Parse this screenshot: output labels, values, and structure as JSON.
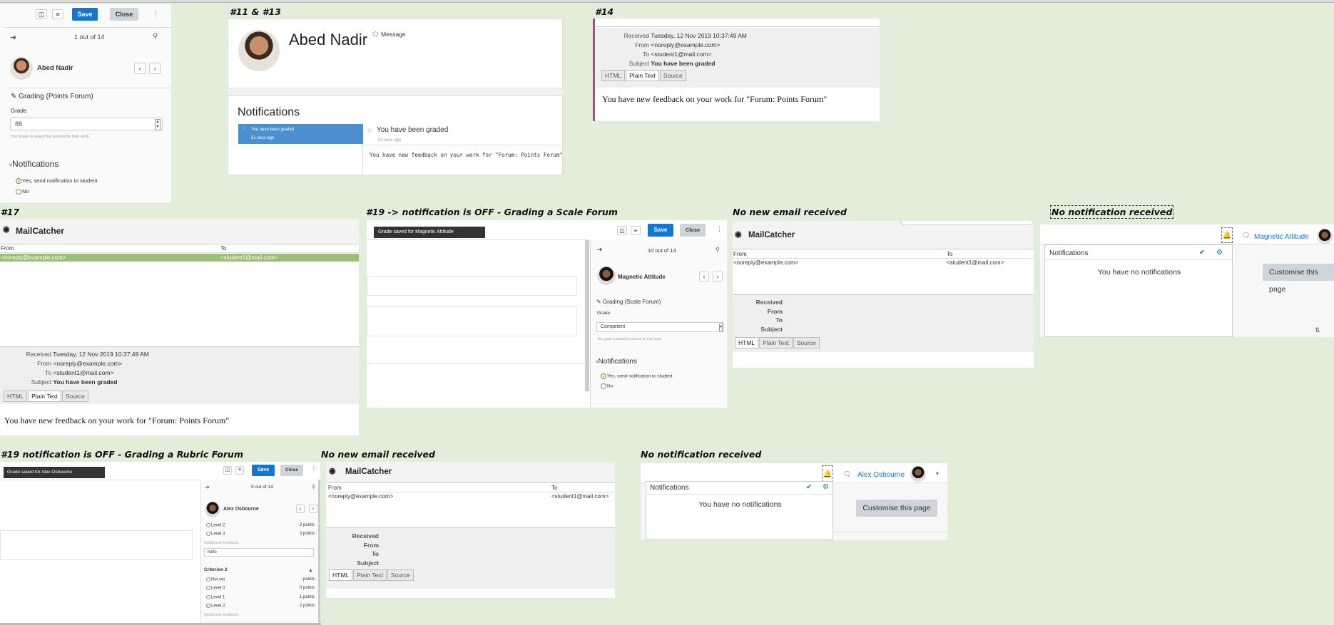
{
  "captions": {
    "c1": "#11 & #13",
    "c2": "#14",
    "c3": "#17",
    "c4": "#19 -> notification is OFF - Grading a Scale Forum",
    "c5": "No new email received",
    "c6": "No notification received",
    "c7": "#19 notification is OFF - Grading a Rubric Forum",
    "c8": "No new email received",
    "c9": "No notification received"
  },
  "grader1": {
    "save": "Save",
    "close": "Close",
    "count": "1 out of 14",
    "user": "Abed Nadir",
    "grading": "Grading (Points Forum)",
    "grade_label": "Grade",
    "grade_value": "88",
    "grade_help": "The grade to award this person for their work.",
    "notifications": "Notifications",
    "yes": "Yes, send notification to student",
    "no": "No"
  },
  "profile": {
    "name": "Abed Nadir",
    "message": "Message",
    "notifications_title": "Notifications",
    "item_title": "You have been graded",
    "item_time": "51 secs ago",
    "detail_title": "You have been graded",
    "detail_time": "51 secs ago",
    "detail_body": "You have new feedback on your work for \"Forum: Points Forum\""
  },
  "mail14": {
    "received_label": "Received",
    "received": "Tuesday, 12 Nov 2019 10:37:49 AM",
    "from_label": "From",
    "from": "<noreply@example.com>",
    "to_label": "To",
    "to": "<student1@mail.com>",
    "subject_label": "Subject",
    "subject": "You have been graded",
    "tabs": [
      "HTML",
      "Plain Text",
      "Source"
    ],
    "body": "You have new feedback on your work for \"Forum: Points Forum\""
  },
  "mail17": {
    "brand": "MailCatcher",
    "col_from": "From",
    "col_to": "To",
    "row_from": "<noreply@example.com>",
    "row_to": "<student1@mail.com>",
    "received_label": "Received",
    "received": "Tuesday, 12 Nov 2019 10:37:49 AM",
    "from_label": "From",
    "from": "<noreply@example.com>",
    "to_label": "To",
    "to": "<student1@mail.com>",
    "subject_label": "Subject",
    "subject": "You have been graded",
    "tabs": [
      "HTML",
      "Plain Text",
      "Source"
    ],
    "body": "You have new feedback on your work for \"Forum: Points Forum\""
  },
  "grader2": {
    "toast": "Grade saved for Magnetic Attitude",
    "save": "Save",
    "close": "Close",
    "count": "10 out of 14",
    "user": "Magnetic Attitude",
    "grading": "Grading (Scale Forum)",
    "grade_label": "Grade",
    "grade_value": "Competent",
    "grade_help": "The grade to award this person for their work.",
    "notifications": "Notifications",
    "yes": "Yes, send notification to student",
    "no": "No"
  },
  "mail_a": {
    "brand": "MailCatcher",
    "col_from": "From",
    "col_to": "To",
    "row_from": "<noreply@example.com>",
    "row_to": "<student1@mail.com>",
    "received_label": "Received",
    "from_label": "From",
    "to_label": "To",
    "subject_label": "Subject",
    "tabs": [
      "HTML",
      "Plain Text",
      "Source"
    ]
  },
  "notif_a": {
    "user": "Magnetic Attitude",
    "title": "Notifications",
    "empty": "You have no notifications",
    "customise": "Customise this page"
  },
  "grader3": {
    "toast": "Grade saved for Alex Osbourne",
    "save": "Save",
    "close": "Close",
    "count": "9 out of 14",
    "user": "Alex Osbourne",
    "r1": "Level 2",
    "r1p": "2 points",
    "r2": "Level 3",
    "r2p": "3 points",
    "feedback_label": "Additional feedback",
    "feedback_value": "hello",
    "criterion": "Criterion 2",
    "c0": "Not set",
    "c0p": "- points",
    "c1": "Level 0",
    "c1p": "0 points",
    "c2": "Level 1",
    "c2p": "1 points",
    "c3": "Level 2",
    "c3p": "2 points",
    "feedback2": "Additional feedback"
  },
  "mail_b": {
    "brand": "MailCatcher",
    "col_from": "From",
    "col_to": "To",
    "row_from": "<noreply@example.com>",
    "row_to": "<student1@mail.com>",
    "received_label": "Received",
    "from_label": "From",
    "to_label": "To",
    "subject_label": "Subject",
    "tabs": [
      "HTML",
      "Plain Text",
      "Source"
    ]
  },
  "notif_b": {
    "user": "Alex Osbourne",
    "title": "Notifications",
    "empty": "You have no notifications",
    "customise": "Customise this page"
  },
  "colors": {
    "background": "#e2edda",
    "primary": "#1177d1",
    "selected_row": "#9dbe78",
    "notif_selected": "#4b8fcf"
  }
}
